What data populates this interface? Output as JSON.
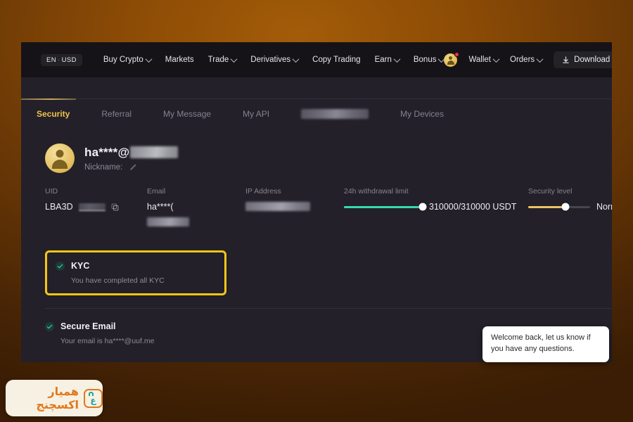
{
  "topbar": {
    "lang": "EN",
    "separator": "·",
    "currency": "USD",
    "nav": [
      {
        "label": "Buy Crypto",
        "caret": true
      },
      {
        "label": "Markets",
        "caret": false
      },
      {
        "label": "Trade",
        "caret": true
      },
      {
        "label": "Derivatives",
        "caret": true
      },
      {
        "label": "Copy Trading",
        "caret": false
      },
      {
        "label": "Earn",
        "caret": true
      },
      {
        "label": "Bonus",
        "caret": true
      }
    ],
    "wallet": "Wallet",
    "orders": "Orders",
    "download": "Download",
    "avatar_icon": "user-avatar-icon",
    "notification_icon": "notification-dot",
    "download_icon": "download-icon"
  },
  "tabs": [
    {
      "label": "Security",
      "active": true
    },
    {
      "label": "Referral",
      "active": false
    },
    {
      "label": "My Message",
      "active": false
    },
    {
      "label": "My API",
      "active": false
    },
    {
      "label": "",
      "active": false,
      "redacted": true
    },
    {
      "label": "My Devices",
      "active": false
    }
  ],
  "profile": {
    "username": "ha****@",
    "username_redacted": true,
    "nickname_label": "Nickname:",
    "edit_icon": "pencil-icon",
    "avatar_icon": "user-avatar-icon"
  },
  "stats": {
    "uid": {
      "label": "UID",
      "value": "LBA3D",
      "masked": true,
      "copy_icon": "copy-icon"
    },
    "email": {
      "label": "Email",
      "value": "ha****(",
      "masked": true
    },
    "ip": {
      "label": "IP Address",
      "value": "",
      "masked": true
    },
    "withdrawal": {
      "label": "24h withdrawal limit",
      "value": "310000/310000 USDT",
      "percent": 100,
      "color": "#35dbaf"
    },
    "security_level": {
      "label": "Security level",
      "value": "Norm",
      "percent": 60,
      "color": "#ecc264"
    }
  },
  "cards": [
    {
      "title": "KYC",
      "subtitle": "You have completed all KYC",
      "status_icon": "check-circle-icon",
      "highlighted": true
    },
    {
      "title": "Secure Email",
      "subtitle": "Your email is ha****@uuf.me",
      "status_icon": "check-circle-icon",
      "highlighted": false
    }
  ],
  "chat": {
    "message": "Welcome back, let us know if you have any questions."
  },
  "watermark": {
    "text": "همیار اکسچنج",
    "mark_glyph": "ع",
    "logo_icon": "hamyar-exchange-logo"
  },
  "colors": {
    "accent_gold": "#f0c14b",
    "highlight_border": "#f5c518",
    "teal": "#35dbaf",
    "panel_bg": "#232029",
    "topbar_bg": "#151318",
    "notification_red": "#f0314a"
  }
}
